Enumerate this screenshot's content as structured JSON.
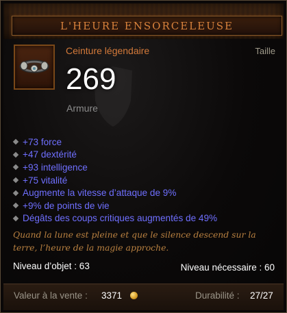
{
  "item": {
    "name": "L'HEURE ENSORCELEUSE",
    "type": "Ceinture légendaire",
    "slot": "Taille",
    "armor_value": "269",
    "armor_label": "Armure",
    "icon": "belt-icon"
  },
  "stats": [
    "+73 force",
    "+47 dextérité",
    "+93 intelligence",
    "+75 vitalité",
    "Augmente la vitesse d’attaque de 9%",
    "+9% de points de vie",
    "Dégâts des coups critiques augmentés de 49%"
  ],
  "flavor_text": "Quand la lune est pleine et que le silence descend sur la terre, l’heure de la magie approche.",
  "levels": {
    "item_level": "Niveau d’objet : 63",
    "required_level": "Niveau nécessaire : 60"
  },
  "footer": {
    "sell_label": "Valeur à la vente :",
    "sell_value": "3371",
    "durability_label": "Durabilité :",
    "durability_value": "27/27"
  },
  "colors": {
    "title": "#d8823c",
    "item_type": "#d47a3a",
    "magic_stat": "#6f6fff",
    "flavor": "#b88040"
  }
}
